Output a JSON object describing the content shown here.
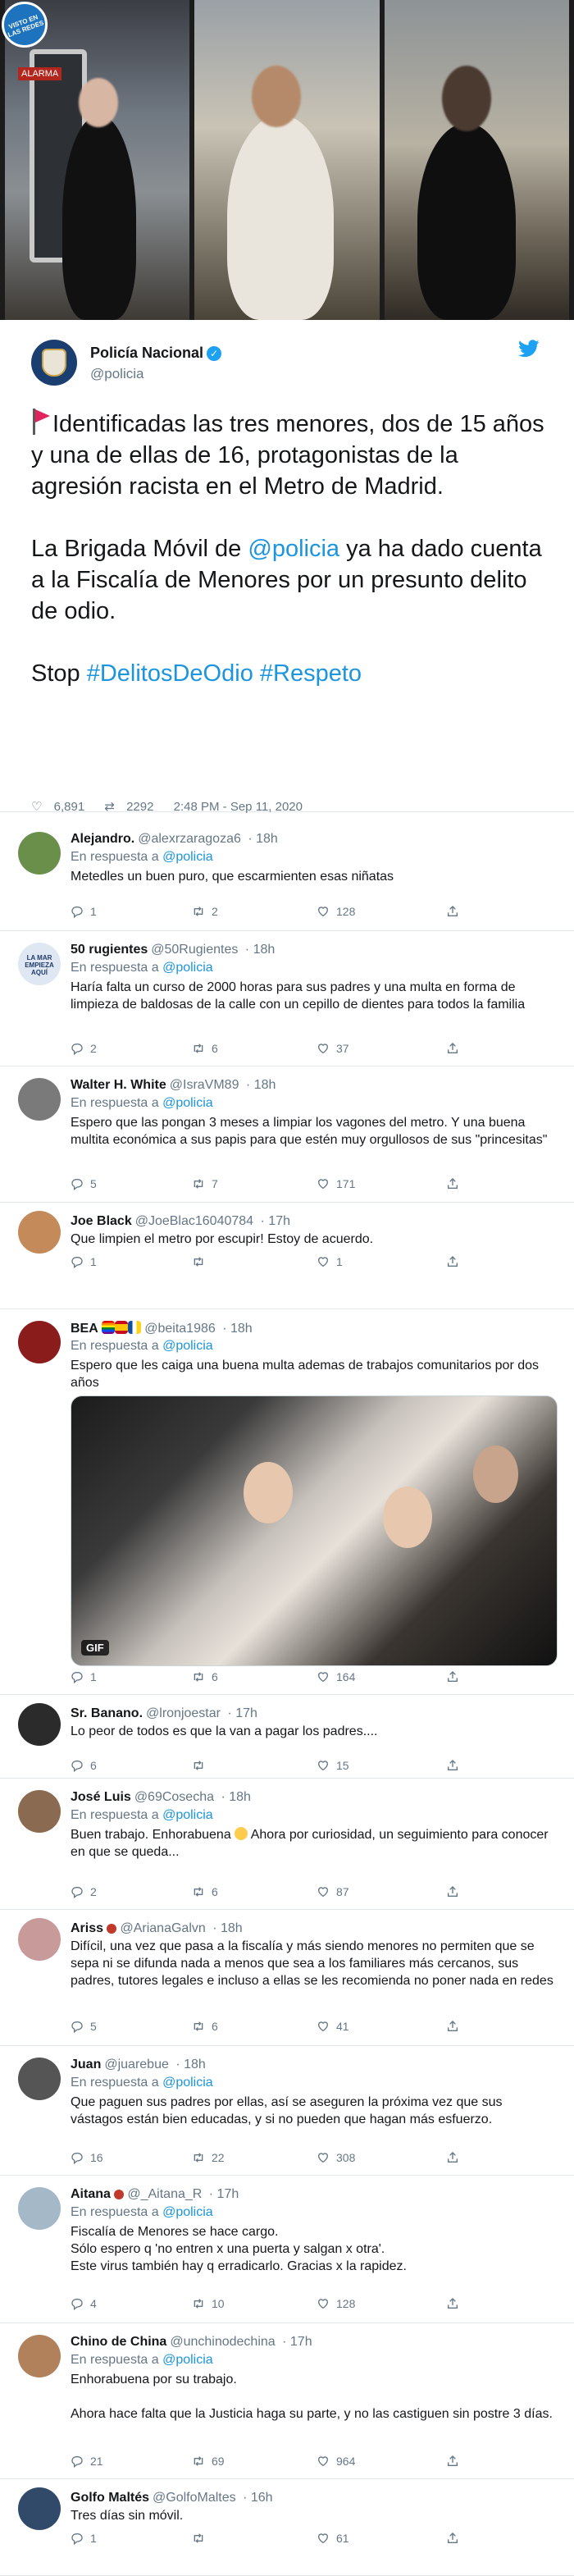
{
  "watermark": {
    "text": "VISTO EN LAS REDES"
  },
  "photos": {
    "alarm_label": "ALARMA"
  },
  "main_tweet": {
    "author_name": "Policía Nacional",
    "author_handle": "@policia",
    "para1": "Identificadas las tres menores, dos de 15 años y una de ellas de 16, protagonistas de la agresión racista en el Metro de Madrid.",
    "para2_before": "La Brigada Móvil de ",
    "para2_mention": "@policia",
    "para2_after": " ya ha dado cuenta a la Fiscalía de Menores por un presunto delito de odio.",
    "para3_prefix": "Stop ",
    "hashtag1": "#DelitosDeOdio",
    "hashtag2": "#Respeto",
    "likes": "6,891",
    "retweets": "2292",
    "timestamp": "2:48 PM - Sep 11, 2020",
    "colors": {
      "link": "#1b95e0",
      "flag": "#e0245e"
    }
  },
  "replies": [
    {
      "name": "Alejandro.",
      "handle": "@alexrzaragoza6",
      "time": "18h",
      "replying_to": "En respuesta a",
      "reply_mention": "@policia",
      "text": "Metedles un buen puro, que escarmienten esas niñatas",
      "replies": "1",
      "retweets": "2",
      "likes": "128"
    },
    {
      "name": "50 rugientes",
      "handle": "@50Rugientes",
      "time": "18h",
      "replying_to": "En respuesta a",
      "reply_mention": "@policia",
      "text": "Haría falta un curso de 2000 horas para sus padres y una multa en forma de limpieza de baldosas de la calle con un cepillo de dientes para todos la familia",
      "avatar_text": "LA MAR EMPIEZA AQUÍ",
      "replies": "2",
      "retweets": "6",
      "likes": "37"
    },
    {
      "name": "Walter H. White",
      "handle": "@IsraVM89",
      "time": "18h",
      "replying_to": "En respuesta a",
      "reply_mention": "@policia",
      "text": "Espero que las pongan 3 meses a limpiar los vagones del metro. Y una buena multita económica a sus papis para que estén muy orgullosos de sus \"princesitas\"",
      "replies": "5",
      "retweets": "7",
      "likes": "171"
    },
    {
      "name": "Joe Black",
      "handle": "@JoeBlac16040784",
      "time": "17h",
      "text": "Que limpien el metro por escupir! Estoy de acuerdo.",
      "replies": "1",
      "retweets": "",
      "likes": "1"
    },
    {
      "name": "BEA",
      "handle": "@beita1986",
      "time": "18h",
      "replying_to": "En respuesta a",
      "reply_mention": "@policia",
      "text": "Espero que les caiga una buena multa ademas de trabajos comunitarios por dos años",
      "gif_label": "GIF",
      "replies": "1",
      "retweets": "6",
      "likes": "164"
    },
    {
      "name": "Sr. Banano.",
      "handle": "@lronjoestar",
      "time": "17h",
      "text": "Lo peor de todos es que la van a pagar los padres....",
      "replies": "6",
      "retweets": "",
      "likes": "15"
    },
    {
      "name": "José Luis",
      "handle": "@69Cosecha",
      "time": "18h",
      "replying_to": "En respuesta a",
      "reply_mention": "@policia",
      "text_before": "Buen trabajo. Enhorabuena ",
      "text_after": " Ahora por curiosidad, un seguimiento para conocer en que se queda...",
      "replies": "2",
      "retweets": "6",
      "likes": "87"
    },
    {
      "name": "Ariss",
      "handle": "@ArianaGalvn",
      "time": "18h",
      "text": "Difícil, una vez que pasa a la fiscalía y más siendo menores no permiten que se sepa ni se difunda nada a menos que sea a los familiares más cercanos, sus padres, tutores legales e incluso a ellas se les recomienda no poner nada en redes",
      "replies": "5",
      "retweets": "6",
      "likes": "41"
    },
    {
      "name": "Juan",
      "handle": "@juarebue",
      "time": "18h",
      "replying_to": "En respuesta a",
      "reply_mention": "@policia",
      "text": "Que paguen sus padres por ellas, así se aseguren la próxima vez que sus vástagos están bien educadas, y si no pueden que hagan más esfuerzo.",
      "replies": "16",
      "retweets": "22",
      "likes": "308"
    },
    {
      "name": "Aitana",
      "handle": "@_Aitana_R",
      "time": "17h",
      "replying_to": "En respuesta a",
      "reply_mention": "@policia",
      "line1": "Fiscalía de Menores se hace cargo.",
      "line2": "Sólo espero q 'no entren x una puerta y salgan x otra'.",
      "line3": "Este virus también hay q erradicarlo. Gracias x la rapidez.",
      "replies": "4",
      "retweets": "10",
      "likes": "128"
    },
    {
      "name": "Chino de China",
      "handle": "@unchinodechina",
      "time": "17h",
      "replying_to": "En respuesta a",
      "reply_mention": "@policia",
      "line1": "Enhorabuena por su trabajo.",
      "line2": "Ahora hace falta que la Justicia haga su parte, y no las castiguen sin postre 3 días.",
      "replies": "21",
      "retweets": "69",
      "likes": "964"
    },
    {
      "name": "Golfo Maltés",
      "handle": "@GolfoMaltes",
      "time": "16h",
      "text": "Tres días sin móvil.",
      "replies": "1",
      "retweets": "",
      "likes": "61"
    }
  ]
}
